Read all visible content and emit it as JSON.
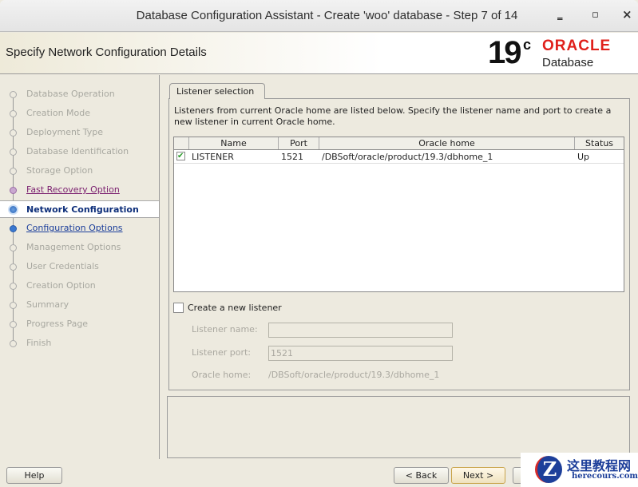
{
  "window": {
    "title": "Database Configuration Assistant - Create 'woo' database - Step 7 of 14",
    "minimize": "‗",
    "maximize": "▫",
    "close": "×"
  },
  "header": {
    "title": "Specify Network Configuration Details",
    "logo_version": "19",
    "logo_c": "c",
    "logo_brand": "ORACLE",
    "logo_product": "Database"
  },
  "steps": [
    {
      "label": "Database Operation",
      "state": "disabled"
    },
    {
      "label": "Creation Mode",
      "state": "disabled"
    },
    {
      "label": "Deployment Type",
      "state": "disabled"
    },
    {
      "label": "Database Identification",
      "state": "disabled"
    },
    {
      "label": "Storage Option",
      "state": "disabled"
    },
    {
      "label": "Fast Recovery Option",
      "state": "done"
    },
    {
      "label": "Network Configuration",
      "state": "current"
    },
    {
      "label": "Configuration Options",
      "state": "next"
    },
    {
      "label": "Management Options",
      "state": "disabled"
    },
    {
      "label": "User Credentials",
      "state": "disabled"
    },
    {
      "label": "Creation Option",
      "state": "disabled"
    },
    {
      "label": "Summary",
      "state": "disabled"
    },
    {
      "label": "Progress Page",
      "state": "disabled"
    },
    {
      "label": "Finish",
      "state": "disabled"
    }
  ],
  "tab": {
    "label": "Listener selection"
  },
  "description": "Listeners from current Oracle home are listed below. Specify the listener name and port to create a new listener in current Oracle home.",
  "table": {
    "columns": [
      "Name",
      "Port",
      "Oracle home",
      "Status"
    ],
    "rows": [
      {
        "checked": true,
        "name": "LISTENER",
        "port": "1521",
        "home": "/DBSoft/oracle/product/19.3/dbhome_1",
        "status": "Up"
      }
    ]
  },
  "create": {
    "label": "Create a new listener",
    "checked": false,
    "name_label": "Listener name:",
    "name_value": "",
    "port_label": "Listener port:",
    "port_value": "1521",
    "home_label": "Oracle home:",
    "home_value": "/DBSoft/oracle/product/19.3/dbhome_1"
  },
  "buttons": {
    "help": "Help",
    "back": "< Back",
    "next": "Next >"
  },
  "watermark": {
    "cn": "这里教程网",
    "en": "herecours.com",
    "letter": "Z"
  }
}
